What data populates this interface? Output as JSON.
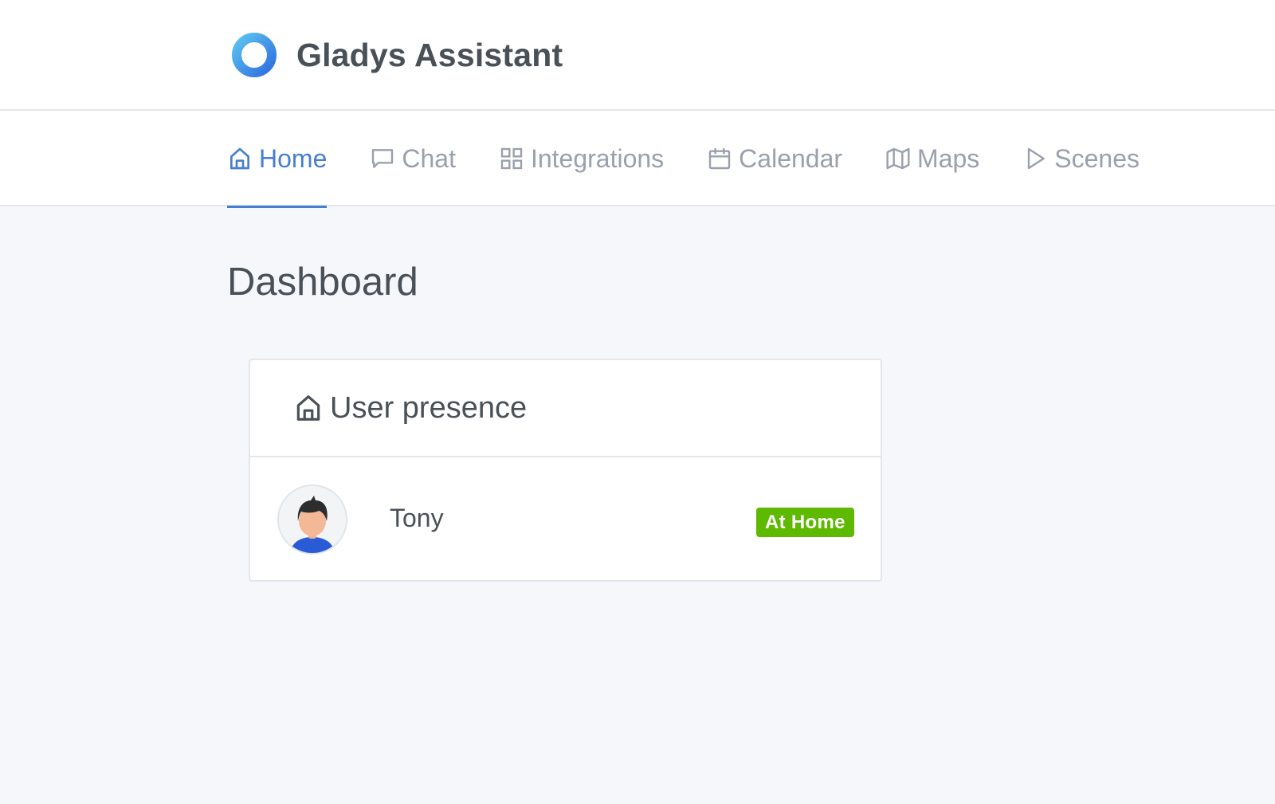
{
  "app": {
    "name": "Gladys Assistant",
    "logo_icon": "gladys-ring-logo",
    "accent_color": "#467fcf"
  },
  "nav": {
    "items": [
      {
        "label": "Home",
        "icon": "home-icon",
        "active": true
      },
      {
        "label": "Chat",
        "icon": "chat-icon",
        "active": false
      },
      {
        "label": "Integrations",
        "icon": "grid-icon",
        "active": false
      },
      {
        "label": "Calendar",
        "icon": "calendar-icon",
        "active": false
      },
      {
        "label": "Maps",
        "icon": "map-icon",
        "active": false
      },
      {
        "label": "Scenes",
        "icon": "play-icon",
        "active": false
      }
    ]
  },
  "page": {
    "title": "Dashboard"
  },
  "user_presence_card": {
    "title": "User presence",
    "icon": "home-icon",
    "users": [
      {
        "name": "Tony",
        "status": "At Home",
        "status_color": "#5eba00",
        "avatar": "male-avatar"
      }
    ]
  }
}
